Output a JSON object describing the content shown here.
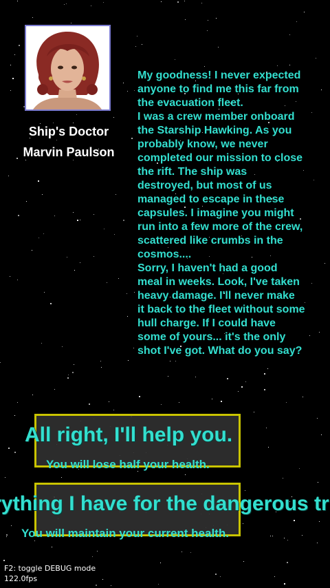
{
  "npc": {
    "role": "Ship's Doctor",
    "name": "Marvin Paulson",
    "portrait": "portrait-woman-red-hair"
  },
  "dialogue": [
    "My goodness! I never expected",
    "anyone to find me this far from",
    "the evacuation fleet.",
    "I was a crew member onboard",
    "the Starship Hawking. As you",
    "probably know, we never",
    "completed our mission to close",
    "the rift. The ship was",
    "destroyed, but most of us",
    "managed to escape in these",
    "capsules. I imagine you might",
    "run into a few more of the crew,",
    "scattered like crumbs in the",
    "cosmos....",
    "Sorry, I haven't had a good",
    "meal in weeks. Look, I've taken",
    "heavy damage. I'll never make",
    "it back to the fleet without some",
    "hull charge. If I could have",
    "some of yours... it's the only",
    "shot I've got. What do you say?"
  ],
  "choices": [
    {
      "label": "All right, I'll help you.",
      "effect": "You will lose half your health."
    },
    {
      "label": "I'll trade everything I have for the dangerous trip.",
      "effect": "You will maintain your current health."
    }
  ],
  "debug": {
    "hint": "F2: toggle DEBUG mode",
    "fps": "122.0fps"
  },
  "colors": {
    "text_cyan": "#33dfcf",
    "choice_border": "#c9c400",
    "portrait_border": "#7b7bd0",
    "background": "#000000"
  }
}
